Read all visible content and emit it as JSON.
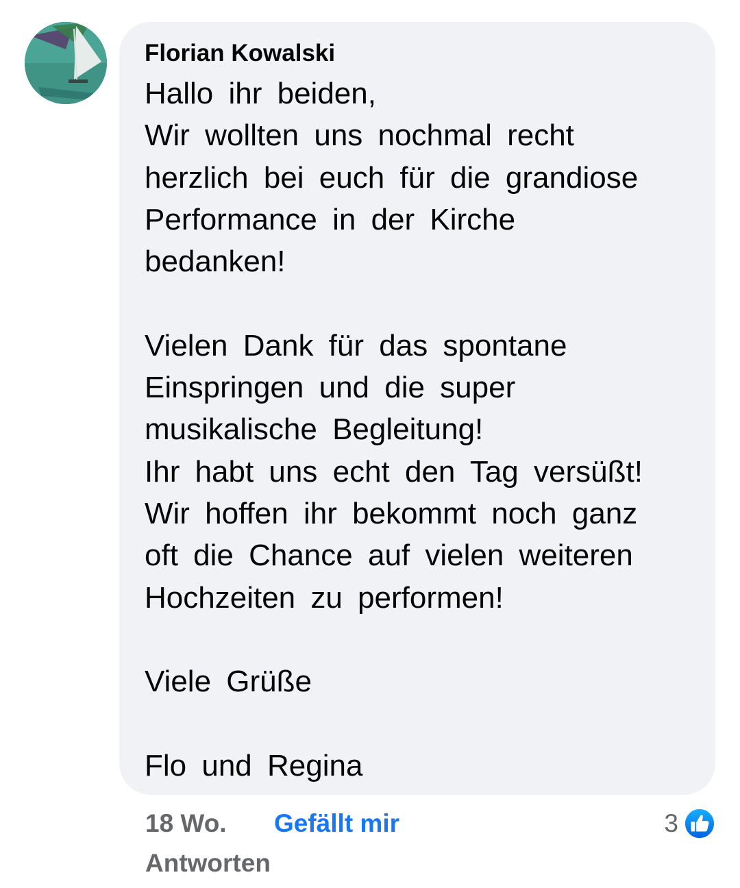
{
  "comment": {
    "author": "Florian Kowalski",
    "lines": [
      "Hallo ihr beiden,",
      "Wir wollten uns nochmal recht",
      "herzlich bei euch für die grandiose",
      "Performance in der Kirche",
      "bedanken!",
      "",
      "Vielen Dank für das spontane",
      "Einspringen und die super",
      "musikalische Begleitung!",
      "Ihr habt uns echt den Tag versüßt!",
      "Wir hoffen ihr bekommt noch ganz",
      "oft die Chance auf vielen weiteren",
      "Hochzeiten zu performen!",
      "",
      "Viele Grüße",
      "",
      "Flo und Regina"
    ],
    "bubble_color": "#f0f2f5"
  },
  "footer": {
    "timestamp": "18 Wo.",
    "like_label": "Gefällt mir",
    "reply_label": "Antworten",
    "reaction_count": "3",
    "reaction_icon": "thumbs-up-icon"
  },
  "colors": {
    "link_blue": "#1877f2",
    "meta_gray": "#65676b",
    "text": "#050505"
  }
}
